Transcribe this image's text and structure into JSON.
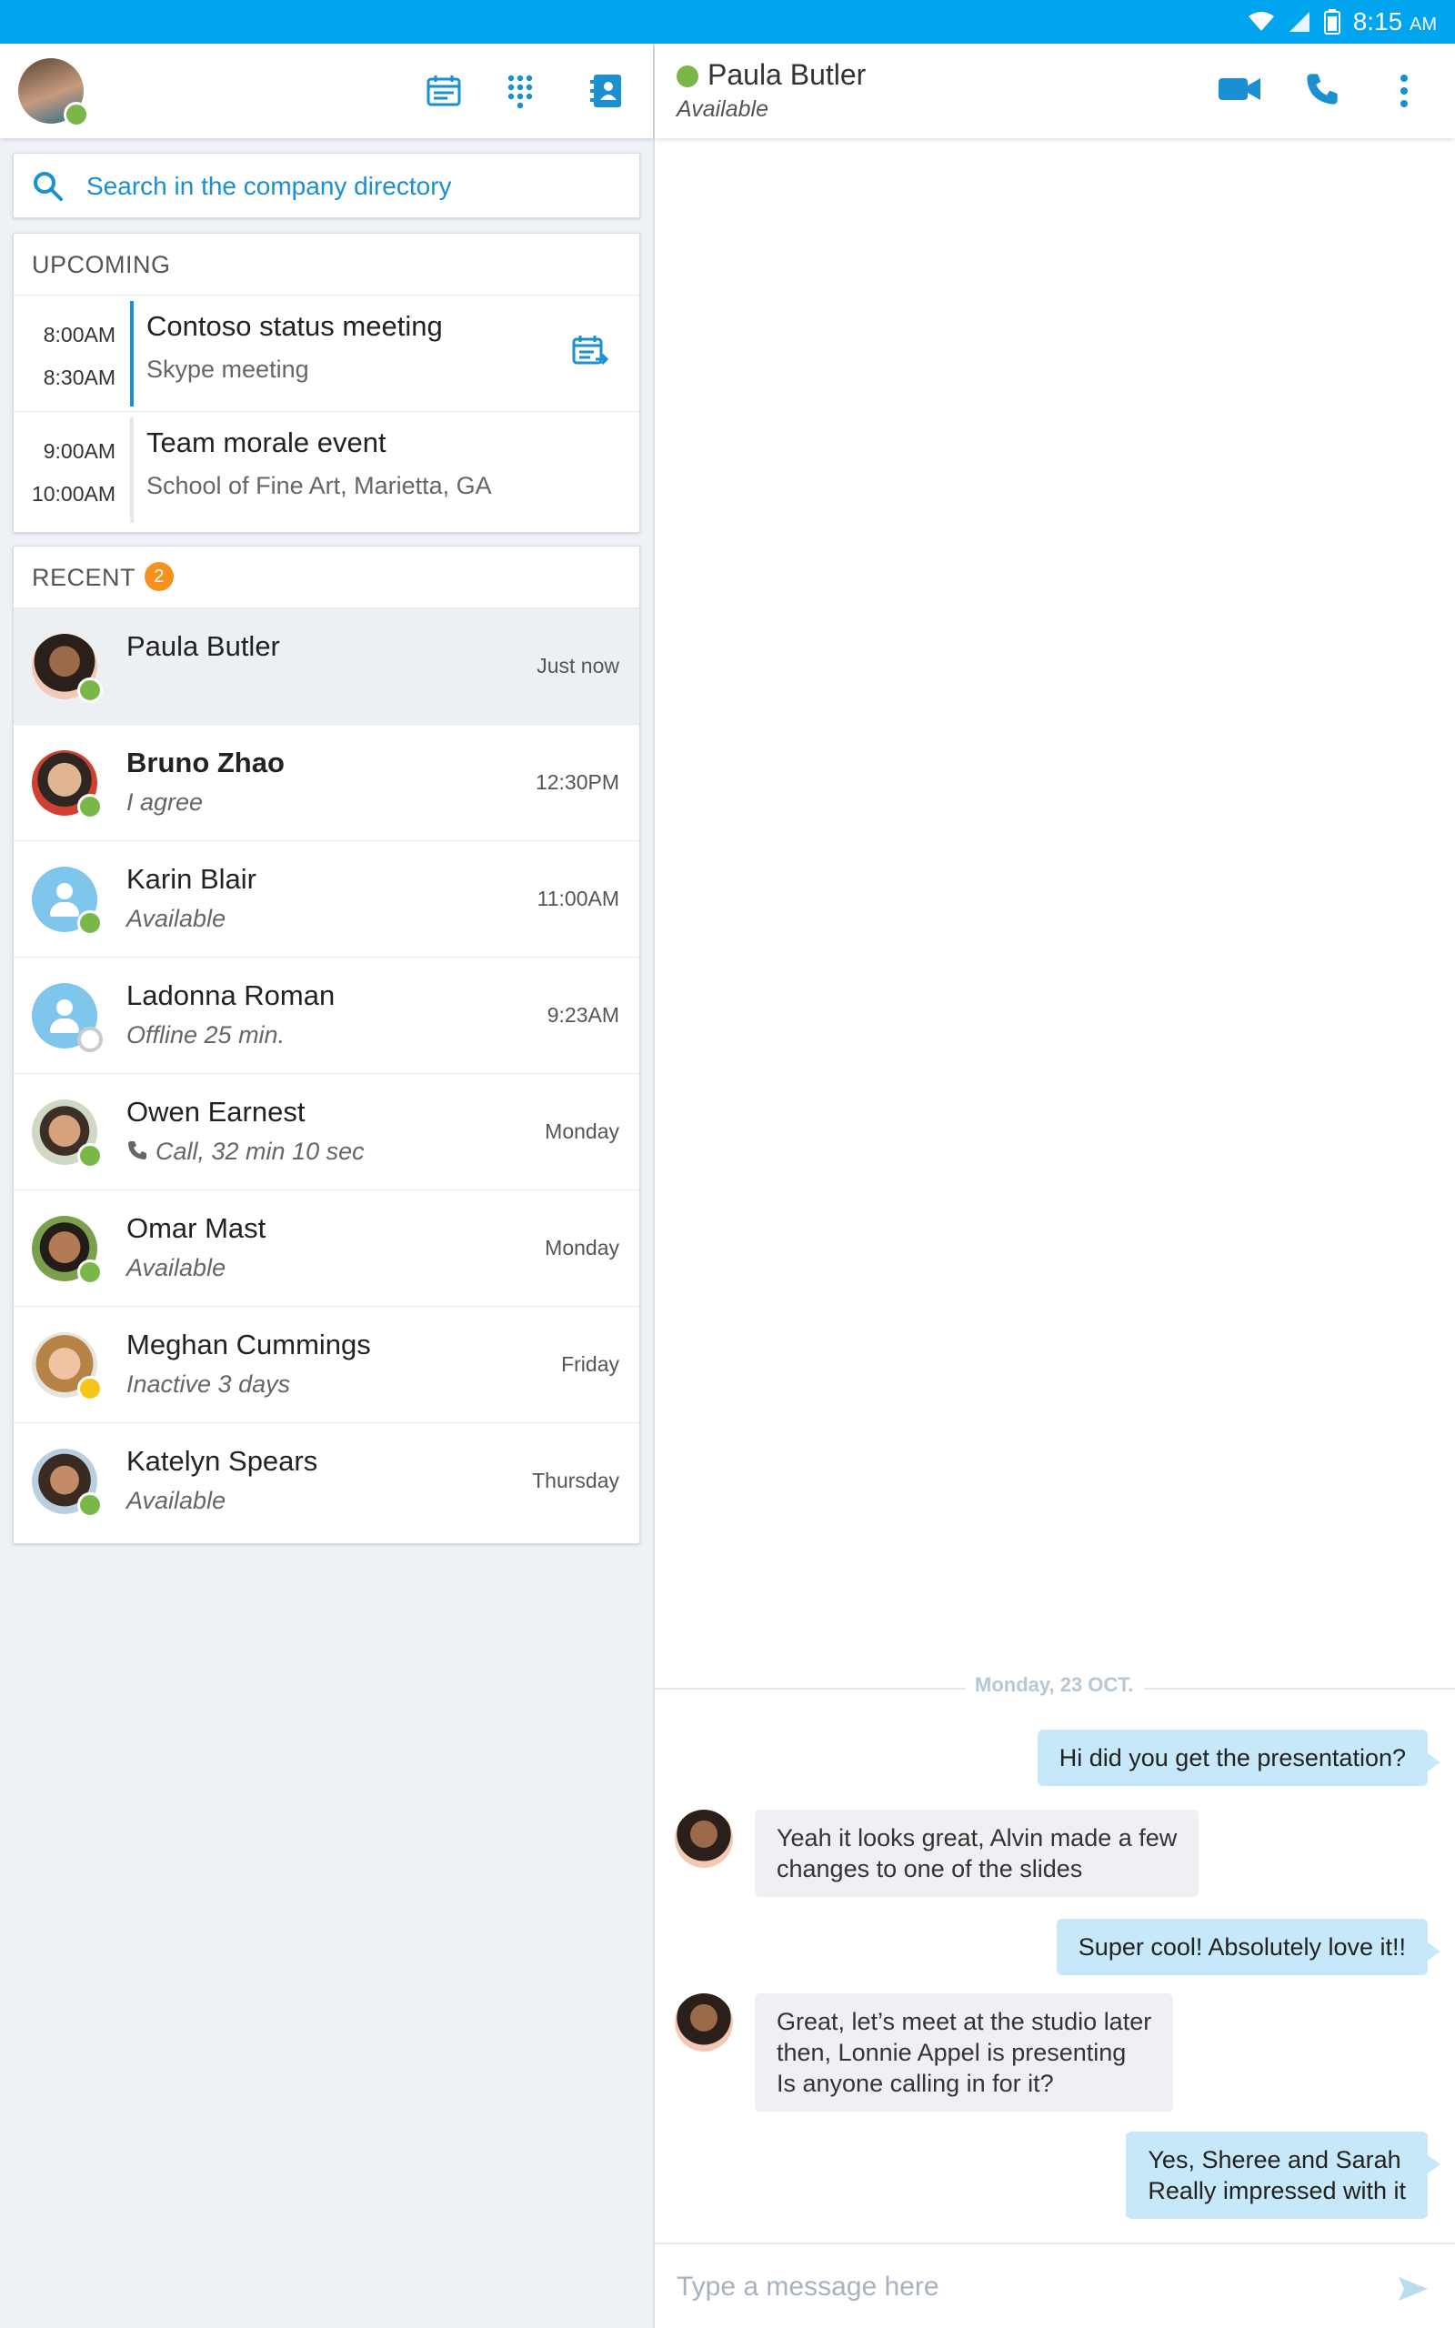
{
  "status_bar": {
    "time": "8:15",
    "ampm": "AM"
  },
  "search": {
    "label": "Search in the company directory"
  },
  "upcoming": {
    "title": "UPCOMING",
    "meetings": [
      {
        "start": "8:00AM",
        "end": "8:30AM",
        "title": "Contoso status meeting",
        "subtitle": "Skype meeting"
      },
      {
        "start": "9:00AM",
        "end": "10:00AM",
        "title": "Team morale event",
        "subtitle": "School of Fine Art, Marietta, GA"
      }
    ]
  },
  "recent": {
    "title": "RECENT",
    "badge": "2",
    "contacts": [
      {
        "name": "Paula Butler",
        "status": "",
        "time": "Just now",
        "presence": "available"
      },
      {
        "name": "Bruno Zhao",
        "status": "I agree",
        "time": "12:30PM",
        "presence": "available"
      },
      {
        "name": "Karin Blair",
        "status": "Available",
        "time": "11:00AM",
        "presence": "available"
      },
      {
        "name": "Ladonna Roman",
        "status": "Offline 25 min.",
        "time": "9:23AM",
        "presence": "offline"
      },
      {
        "name": "Owen Earnest",
        "status": "Call, 32 min 10 sec",
        "time": "Monday",
        "presence": "available"
      },
      {
        "name": "Omar Mast",
        "status": "Available",
        "time": "Monday",
        "presence": "available"
      },
      {
        "name": "Meghan Cummings",
        "status": "Inactive 3 days",
        "time": "Friday",
        "presence": "away"
      },
      {
        "name": "Katelyn Spears",
        "status": "Available",
        "time": "Thursday",
        "presence": "available"
      }
    ]
  },
  "chat": {
    "name": "Paula Butler",
    "status": "Available",
    "date": "Monday, 23 OCT.",
    "messages": [
      {
        "dir": "out",
        "text": "Hi did you get the presentation?"
      },
      {
        "dir": "in",
        "lines": [
          "Yeah it looks great, Alvin made a few",
          "changes to one of the slides"
        ]
      },
      {
        "dir": "out",
        "text": "Super cool! Absolutely love it!!"
      },
      {
        "dir": "in",
        "lines": [
          "Great, let’s meet at the studio later",
          "then, Lonnie Appel is presenting",
          "Is anyone calling in for it?"
        ]
      },
      {
        "dir": "out",
        "lines": [
          "Yes, Sheree and Sarah",
          "Really impressed with it"
        ]
      }
    ],
    "compose_placeholder": "Type a message here"
  },
  "colors": {
    "accent": "#00a4ef",
    "link": "#1a8fd1",
    "available": "#7ab648",
    "away": "#f5c518",
    "badge": "#f7911d",
    "bubble_out": "#c7e8f8",
    "bubble_in": "#eef0f3"
  },
  "icons": {
    "status_bar": [
      "wifi-icon",
      "cell-signal-icon",
      "battery-icon"
    ],
    "left_header": [
      "calendar-icon",
      "dialpad-icon",
      "contacts-icon"
    ],
    "right_header": [
      "video-call-icon",
      "phone-call-icon",
      "more-options-icon"
    ],
    "search": "search-icon",
    "meeting": "meeting-join-icon",
    "call_status": "phone-icon",
    "compose": "send-icon"
  }
}
